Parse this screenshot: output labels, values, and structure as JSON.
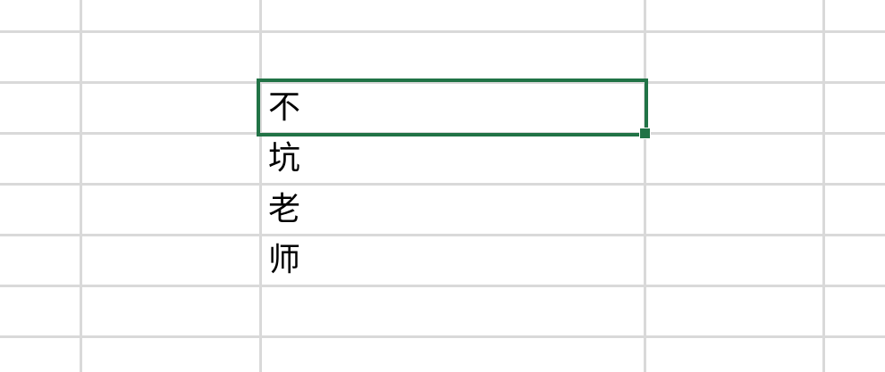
{
  "spreadsheet": {
    "accent_color": "#217346",
    "gridline_color": "#d9d9d9",
    "cells": [
      {
        "text": "不",
        "selected": true
      },
      {
        "text": "坑",
        "selected": false
      },
      {
        "text": "老",
        "selected": false
      },
      {
        "text": "师",
        "selected": false
      }
    ]
  }
}
